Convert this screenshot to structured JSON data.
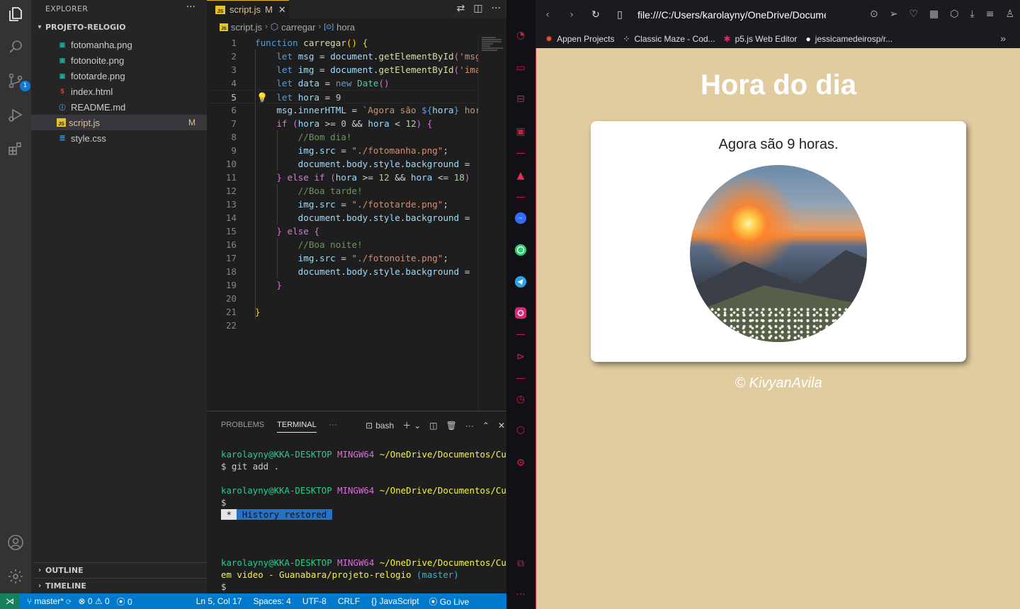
{
  "explorer": {
    "title": "EXPLORER",
    "more": "···",
    "folder": "PROJETO-RELOGIO",
    "files": [
      {
        "name": "fotomanha.png",
        "type": "png",
        "modified": ""
      },
      {
        "name": "fotonoite.png",
        "type": "png",
        "modified": ""
      },
      {
        "name": "fototarde.png",
        "type": "png",
        "modified": ""
      },
      {
        "name": "index.html",
        "type": "html",
        "modified": ""
      },
      {
        "name": "README.md",
        "type": "md",
        "modified": ""
      },
      {
        "name": "script.js",
        "type": "js",
        "modified": "M"
      },
      {
        "name": "style.css",
        "type": "css",
        "modified": ""
      }
    ],
    "outline": "OUTLINE",
    "timeline": "TIMELINE"
  },
  "activity": {
    "scm_badge": "1"
  },
  "editor": {
    "tab_name": "script.js",
    "tab_modified": "M",
    "tab_close": "✕",
    "breadcrumb": [
      "script.js",
      "carregar",
      "hora"
    ],
    "line_numbers": [
      "1",
      "2",
      "3",
      "4",
      "5",
      "6",
      "7",
      "8",
      "9",
      "10",
      "11",
      "12",
      "13",
      "14",
      "15",
      "16",
      "17",
      "18",
      "19",
      "20",
      "21",
      "22"
    ],
    "current_line": 5
  },
  "panel": {
    "tabs": [
      "PROBLEMS",
      "TERMINAL"
    ],
    "active_tab": "TERMINAL",
    "shell": "bash",
    "terminal": {
      "user1": "karolayny@KKA-DESKTOP",
      "env1": "MINGW64",
      "path1": "~/OneDrive/Documentos/Curs",
      "cmd1": "$ git add .",
      "user2": "karolayny@KKA-DESKTOP",
      "env2": "MINGW64",
      "path2": "~/OneDrive/Documentos/Curs",
      "prompt2": "$",
      "history_star": " * ",
      "history": " History restored ",
      "user3": "karolayny@KKA-DESKTOP",
      "env3": "MINGW64",
      "path3": "~/OneDrive/Documentos/Curso",
      "path3b": "em video - Guanabara/projeto-relogio",
      "branch3": "(master)",
      "prompt3": "$"
    }
  },
  "status": {
    "branch": "master*",
    "errors": "0",
    "warnings": "0",
    "ports": "0",
    "position": "Ln 5, Col 17",
    "spaces": "Spaces: 4",
    "encoding": "UTF-8",
    "eol": "CRLF",
    "language": "JavaScript",
    "golive": "Go Live"
  },
  "browser": {
    "url": "file:///C:/Users/karolayny/OneDrive/Documentos",
    "bookmarks": [
      "Appen Projects",
      "Classic Maze - Cod...",
      "p5.js Web Editor",
      "jessicamedeirosp/r..."
    ],
    "bookmarks_more": "»",
    "page": {
      "title": "Hora do dia",
      "message": "Agora são 9 horas.",
      "footer": "© KivyanAvila"
    }
  },
  "colors": {
    "page_bg": "#e0cc9f",
    "statusbar": "#007acc",
    "accent_red": "#c9213c"
  }
}
